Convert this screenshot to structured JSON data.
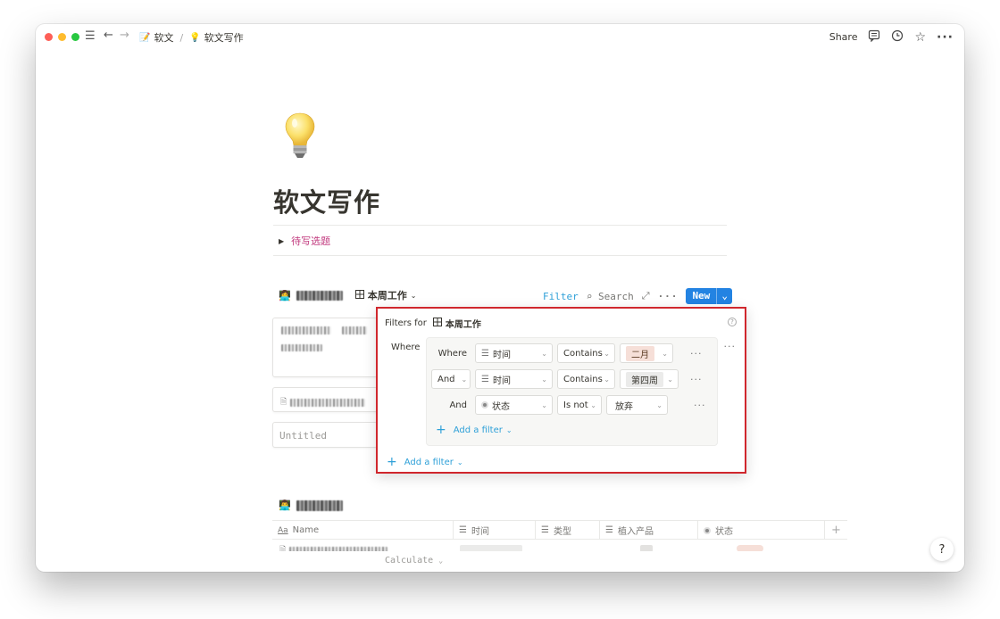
{
  "breadcrumb": {
    "parent": "软文",
    "separator": "/",
    "current": "软文写作"
  },
  "topbar": {
    "share": "Share"
  },
  "page": {
    "title": "软文写作",
    "toggle_label": "待写选题"
  },
  "database1": {
    "view_name": "本周工作",
    "toolbar": {
      "filter": "Filter",
      "search": "Search",
      "new": "New"
    },
    "cards": {
      "untitled": "Untitled"
    }
  },
  "filter_popup": {
    "header_prefix": "Filters for",
    "view_name": "本周工作",
    "where": "Where",
    "rules": [
      {
        "conjunction": "Where",
        "property": "时间",
        "operator": "Contains",
        "value": "二月",
        "value_bg": "#f6dfd8"
      },
      {
        "conjunction": "And",
        "property": "时间",
        "operator": "Contains",
        "value": "第四周",
        "value_bg": "#ebebea"
      },
      {
        "conjunction": "And",
        "property": "状态",
        "operator": "Is not",
        "value": "放弃",
        "value_bg": "#ffffff"
      }
    ],
    "add_filter_inner": "Add a filter",
    "add_filter_outer": "Add a filter"
  },
  "database2": {
    "columns": [
      {
        "icon": "Aa",
        "label": "Name"
      },
      {
        "icon": "list-icon",
        "label": "时间"
      },
      {
        "icon": "list-icon",
        "label": "类型"
      },
      {
        "icon": "list-icon",
        "label": "植入产品"
      },
      {
        "icon": "status-icon",
        "label": "状态"
      }
    ],
    "calculate": "Calculate"
  },
  "help": "?",
  "colors": {
    "accent": "#2383e2",
    "link": "#2ea0d8",
    "highlight_border": "#d0272d",
    "toggle_text": "#c1387d"
  }
}
